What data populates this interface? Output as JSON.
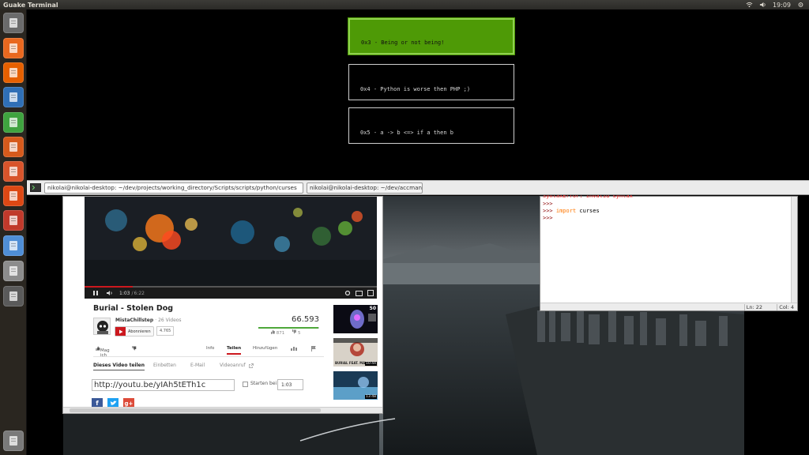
{
  "panel": {
    "app_title": "Guake Terminal",
    "clock": "19:09"
  },
  "launcher": {
    "items": [
      {
        "name": "dash-home-icon",
        "color": "#6b6b6b"
      },
      {
        "name": "files-icon",
        "color": "#e9681f"
      },
      {
        "name": "firefox-icon",
        "color": "#e66000"
      },
      {
        "name": "writer-icon",
        "color": "#2f6fb6"
      },
      {
        "name": "calc-icon",
        "color": "#3fa33f"
      },
      {
        "name": "impress-icon",
        "color": "#d65a1c"
      },
      {
        "name": "software-center-icon",
        "color": "#d8542b"
      },
      {
        "name": "ubuntu-one-icon",
        "color": "#dd4814"
      },
      {
        "name": "system-settings-icon",
        "color": "#c0392b"
      },
      {
        "name": "chromium-icon",
        "color": "#4f8ed6"
      },
      {
        "name": "unknown-app-icon",
        "color": "#8c8c8c"
      },
      {
        "name": "workspace-switcher-icon",
        "color": "#5a5a5a"
      },
      {
        "name": "trash-icon",
        "color": "#7a7a7a"
      }
    ]
  },
  "terminal": {
    "menu_items": [
      {
        "label": "0x3 - Being or not being!",
        "active": true
      },
      {
        "label": "0x4 - Python is worse then PHP ;)",
        "active": false
      },
      {
        "label": "0x5 - a -> b <=> if a then b",
        "active": false
      }
    ]
  },
  "guake_tabs": [
    {
      "label": "nikolai@nikolai-desktop: ~/dev/projects/working_directory/Scripts/scripts/python/curses"
    },
    {
      "label": "nikolai@nikolai-desktop: ~/dev/accman"
    }
  ],
  "youtube": {
    "video_time": "1:03",
    "video_duration": "6:22",
    "progress": 0.165,
    "title": "Burial - Stolen Dog",
    "channel": "MistaChillstep",
    "channel_videos": "· 26 Videos",
    "subscribe_label": "Abonnieren",
    "subscriber_count": "4.765",
    "view_count": "66.593",
    "likes": "871",
    "dislikes": "5",
    "like_ratio": 0.99,
    "like_label": "Mag ich",
    "tabs": {
      "info": "Info",
      "share": "Teilen",
      "add": "Hinzufügen"
    },
    "share_tabs": {
      "share_video": "Dieses Video teilen",
      "embed": "Einbetten",
      "email": "E-Mail",
      "video_call": "Videoanruf"
    },
    "share_url": "http://youtu.be/yIAh5tETh1c",
    "start_at_label": "Starten bei:",
    "start_at_value": "1:03",
    "thumb1_views": "50",
    "thumb2_duration": "10:44",
    "thumb3_duration": "13:48",
    "thumb2_caption": "BURIAL FEAT. MA"
  },
  "python_shell": {
    "lines": [
      {
        "prompt": "",
        "text": "SyntaxError: invalid syntax"
      },
      {
        "prompt": ">>>",
        "text": ""
      },
      {
        "prompt": ">>>",
        "keyword": "import",
        "text": " curses"
      },
      {
        "prompt": ">>>",
        "text": ""
      }
    ],
    "status_ln": "Ln: 22",
    "status_col": "Col: 4"
  }
}
